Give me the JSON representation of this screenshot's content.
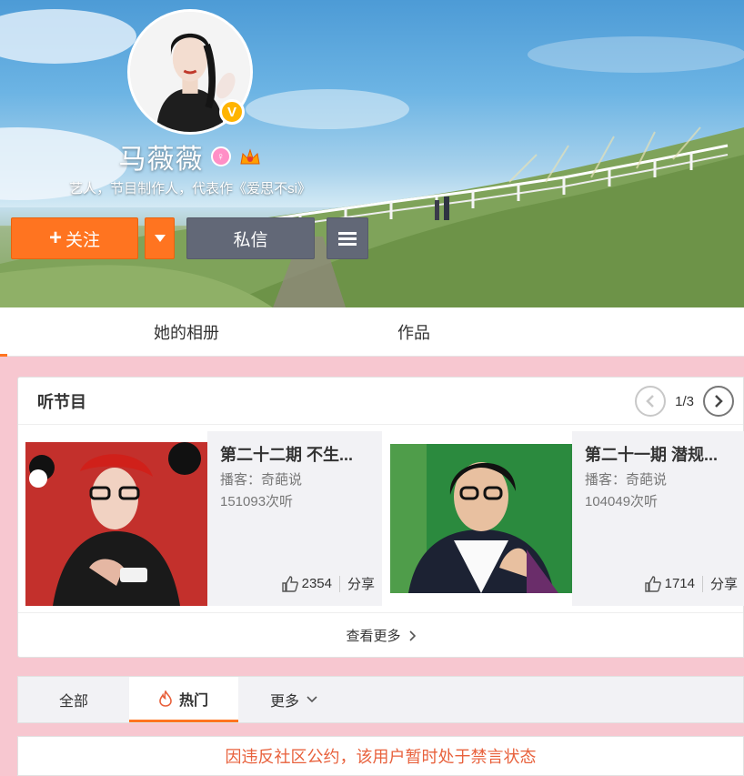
{
  "profile": {
    "name": "马薇薇",
    "description": "艺人，节目制作人，代表作《爱思不si》",
    "verified_badge": "V",
    "gender_icon": "female-icon",
    "badge_icon": "vip-icon"
  },
  "actions": {
    "follow_label": "关注",
    "follow_plus": "+",
    "message_label": "私信"
  },
  "tabs": [
    {
      "label": "她的相册"
    },
    {
      "label": "作品"
    }
  ],
  "programs_card": {
    "title": "听节目",
    "page": "1/3",
    "see_more": "查看更多",
    "items": [
      {
        "title": "第二十二期 不生...",
        "host": "播客：奇葩说",
        "plays": "151093次听",
        "likes": "2354",
        "share": "分享"
      },
      {
        "title": "第二十一期 潜规...",
        "host": "播客：奇葩说",
        "plays": "104049次听",
        "likes": "1714",
        "share": "分享"
      }
    ]
  },
  "feed_tabs": [
    {
      "label": "全部"
    },
    {
      "label": "热门"
    },
    {
      "label": "更多"
    }
  ],
  "notice": "因违反社区公约，该用户暂时处于禁言状态",
  "colors": {
    "accent": "#ff7420",
    "dark_button": "#626877",
    "page_background": "#f7c7d0",
    "notice_text": "#e8613c"
  }
}
